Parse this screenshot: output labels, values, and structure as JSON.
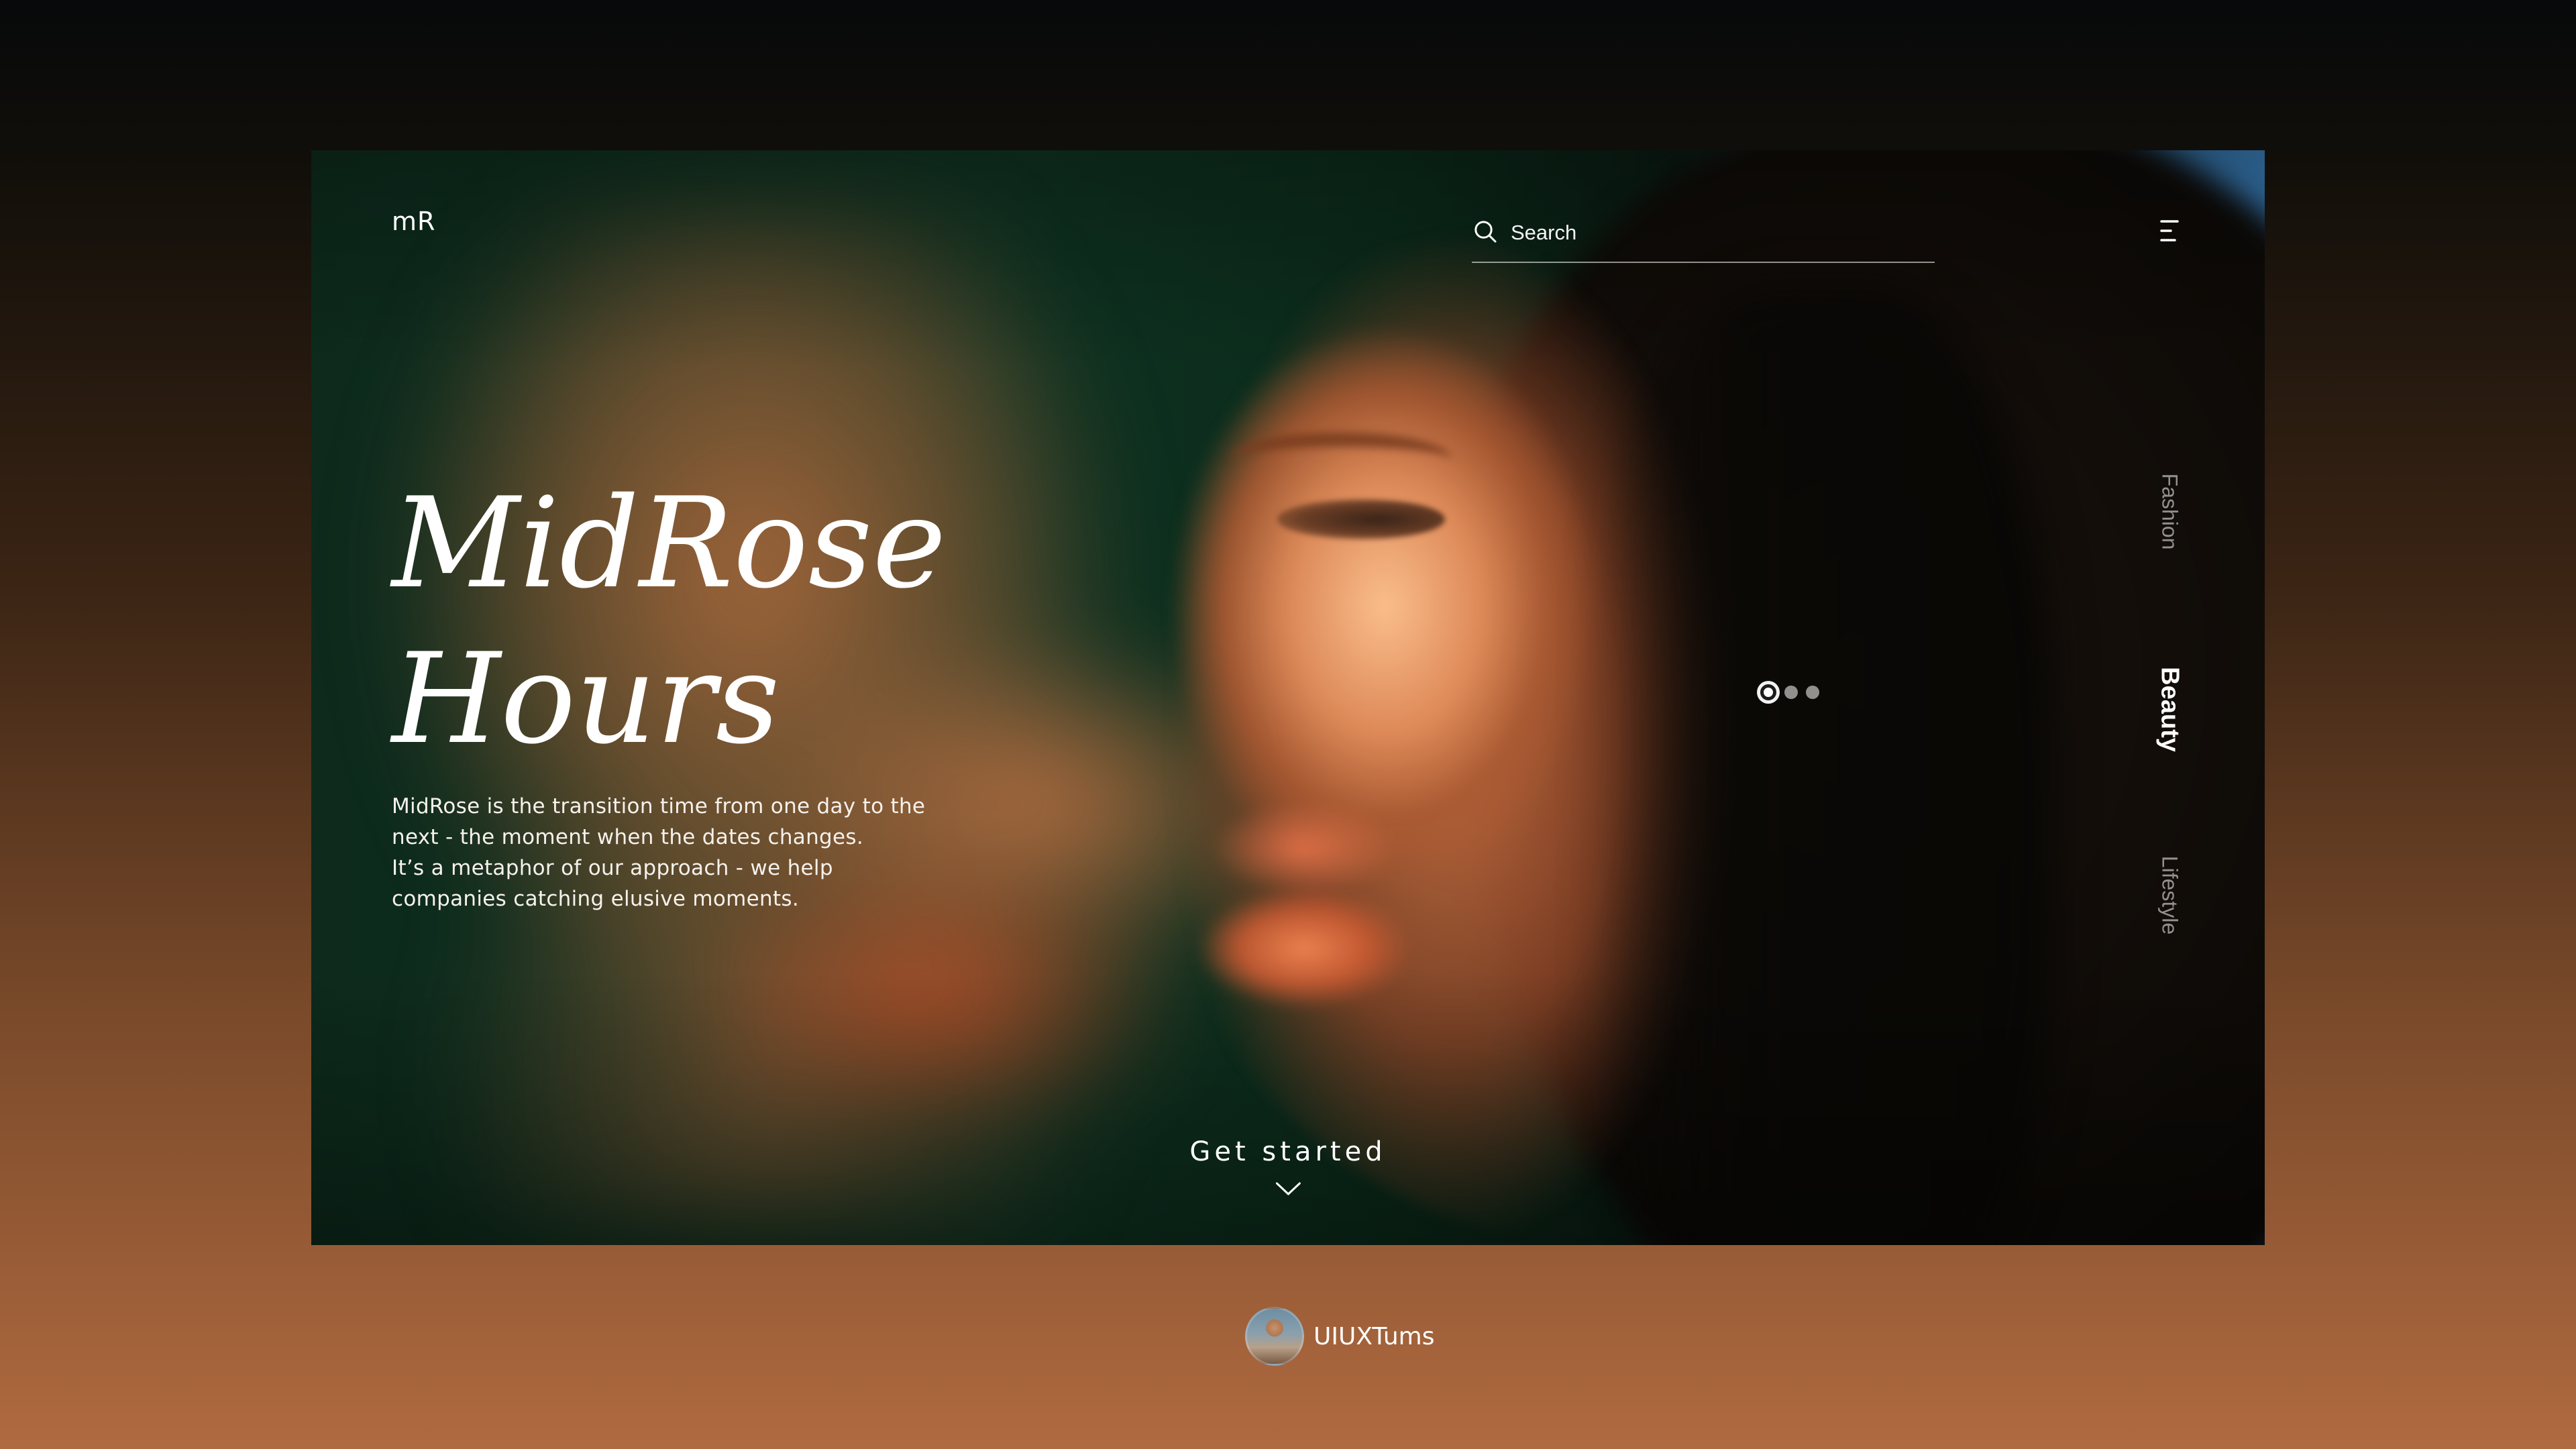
{
  "header": {
    "logo": "mR",
    "search_placeholder": "Search",
    "menu_icon": "hamburger-menu-icon"
  },
  "hero": {
    "title_line1": "MidRose",
    "title_line2": "Hours",
    "description_lines": [
      "MidRose is the transition time from one day to the",
      "next - the moment when the dates changes.",
      "It’s a metaphor of our approach - we help",
      "companies catching elusive moments."
    ]
  },
  "slider": {
    "total": 3,
    "active_index": 0
  },
  "categories": [
    {
      "label": "Fashion",
      "active": false
    },
    {
      "label": "Beauty",
      "active": true
    },
    {
      "label": "Lifestyle",
      "active": false
    }
  ],
  "cta": {
    "label": "Get started",
    "icon": "chevron-down-icon"
  },
  "credit": {
    "name": "UIUXTums"
  },
  "colors": {
    "text": "#ffffff",
    "muted_text": "#ffffff8c",
    "accent_blue": "#3b7bb0",
    "background_bottom": "#b06a40"
  }
}
